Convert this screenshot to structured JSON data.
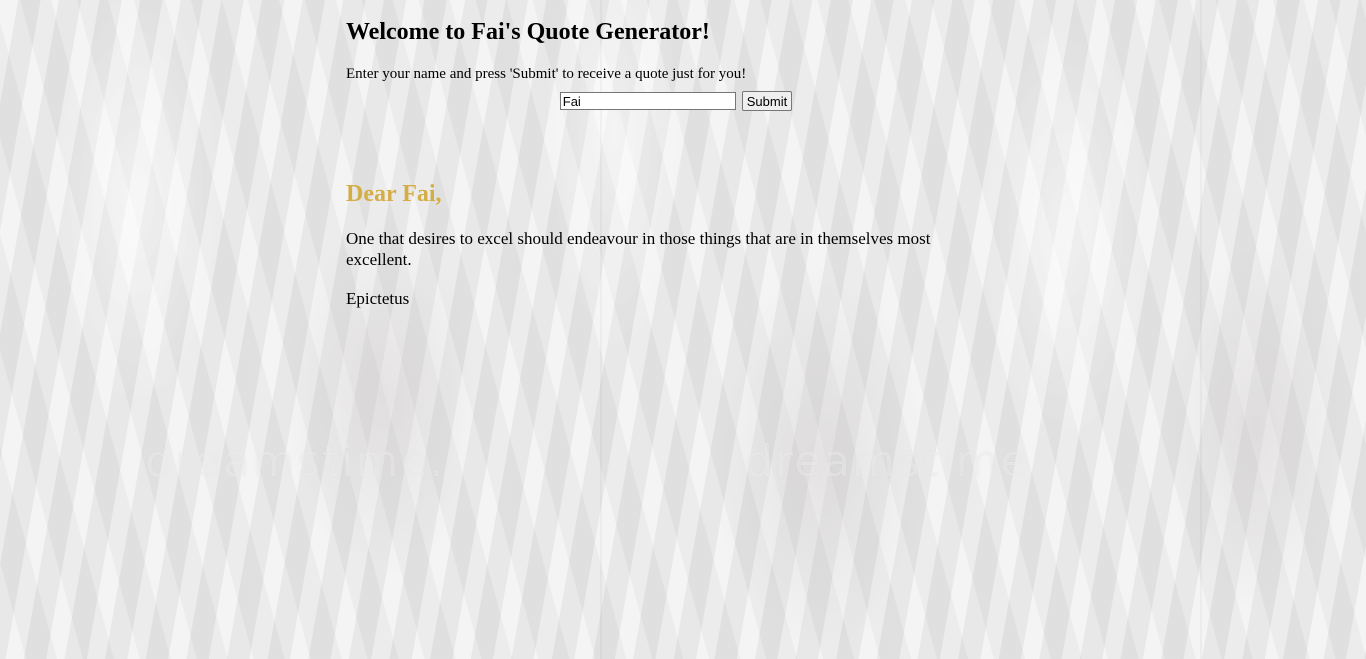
{
  "page": {
    "title": "Welcome to Fai's Quote Generator!",
    "instructions": "Enter your name and press 'Submit' to receive a quote just for you!"
  },
  "form": {
    "name_value": "Fai",
    "submit_label": "Submit"
  },
  "result": {
    "greeting": "Dear Fai,",
    "quote": "One that desires to excel should endeavour in those things that are in themselves most excellent.",
    "author": "Epictetus"
  },
  "background": {
    "watermark_text": "dreamstime."
  },
  "colors": {
    "greeting": "#d4ae45",
    "text": "#000000"
  }
}
